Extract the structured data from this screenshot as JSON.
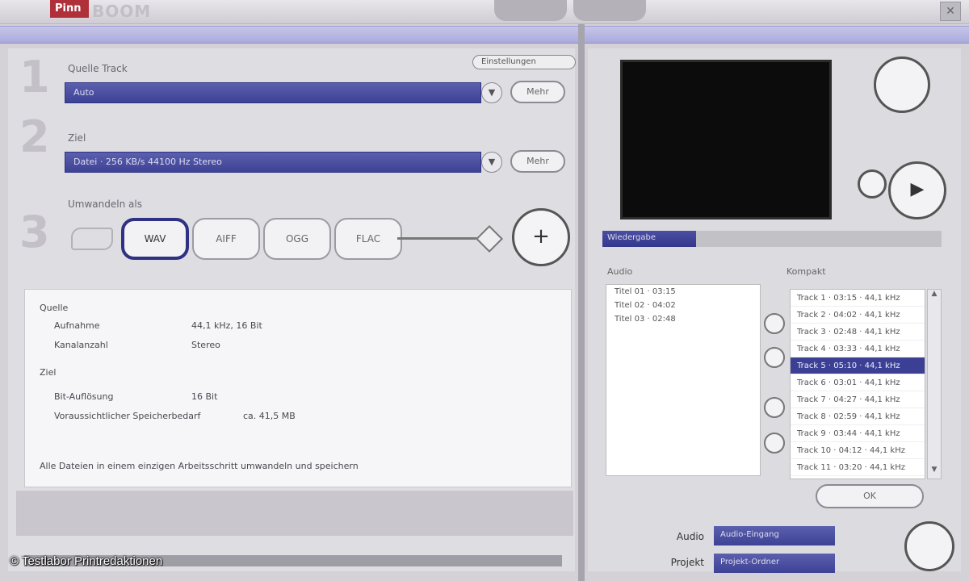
{
  "window": {
    "logo_badge": "Pinn",
    "logo_text": "BOOM",
    "close_glyph": "✕"
  },
  "step1": {
    "number": "1",
    "label": "Quelle Track",
    "value": "Auto",
    "chip": "Einstellungen",
    "button": "Mehr"
  },
  "step2": {
    "number": "2",
    "label": "Ziel",
    "value": "Datei · 256 KB/s 44100 Hz Stereo",
    "button": "Mehr"
  },
  "step3": {
    "number": "3",
    "label": "Umwandeln als",
    "formats": [
      {
        "label": "WAV",
        "active": true
      },
      {
        "label": "AIFF",
        "active": false
      },
      {
        "label": "OGG",
        "active": false
      },
      {
        "label": "FLAC",
        "active": false
      }
    ],
    "go_glyph": "+"
  },
  "info": {
    "heading1": "Quelle",
    "rows1": [
      {
        "label": "Aufnahme",
        "value": "44,1 kHz, 16 Bit"
      },
      {
        "label": "Kanalanzahl",
        "value": "Stereo"
      }
    ],
    "heading2": "Ziel",
    "rows2": [
      {
        "label": "Bit-Auflösung",
        "value": "16 Bit"
      },
      {
        "label": "Voraussichtlicher Speicherbedarf",
        "value": "ca. 41,5 MB"
      }
    ],
    "footer": "Alle Dateien in einem einzigen Arbeitsschritt umwandeln und speichern"
  },
  "preview": {
    "play_glyph": "▶"
  },
  "tabs": {
    "active": "Wiedergabe"
  },
  "audio": {
    "header": "Audio",
    "items": [
      "Titel 01 · 03:15",
      "Titel 02 · 04:02",
      "Titel 03 · 02:48"
    ]
  },
  "compact": {
    "header": "Kompakt",
    "items": [
      "Track 1 · 03:15 · 44,1 kHz",
      "Track 2 · 04:02 · 44,1 kHz",
      "Track 3 · 02:48 · 44,1 kHz",
      "Track 4 · 03:33 · 44,1 kHz",
      "Track 5 · 05:10 · 44,1 kHz",
      "Track 6 · 03:01 · 44,1 kHz",
      "Track 7 · 04:27 · 44,1 kHz",
      "Track 8 · 02:59 · 44,1 kHz",
      "Track 9 · 03:44 · 44,1 kHz",
      "Track 10 · 04:12 · 44,1 kHz",
      "Track 11 · 03:20 · 44,1 kHz"
    ],
    "selected_index": 4,
    "ok_label": "OK"
  },
  "form": {
    "audio_label": "Audio",
    "audio_value": "Audio-Eingang",
    "project_label": "Projekt",
    "project_value": "Projekt-Ordner"
  },
  "watermark": "© Testlabor Printredaktionen"
}
